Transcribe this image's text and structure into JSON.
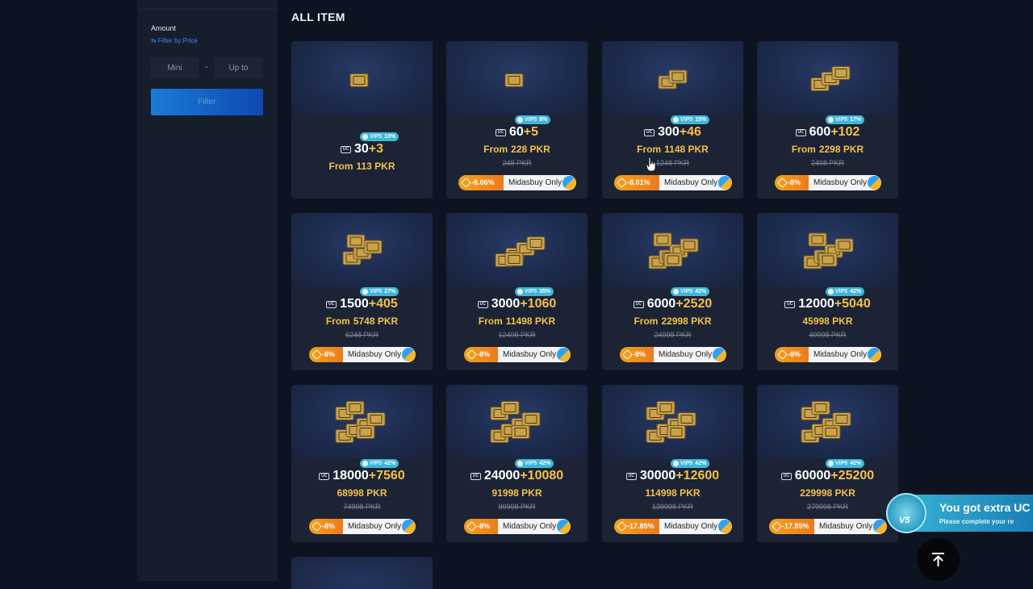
{
  "sidebar": {
    "amount_label": "Amount",
    "filter_by_price": "⇆ Filter by Price",
    "min_placeholder": "Mini",
    "dash": "-",
    "max_placeholder": "Up to",
    "filter_button": "Filter"
  },
  "section_title": "ALL ITEM",
  "colors": {
    "gold": "#f5c04a",
    "vip": "#3fb6d8",
    "discount": "#f3a21b",
    "filter": "#1b7bd6"
  },
  "items": [
    {
      "base": "30",
      "bonus": "+3",
      "vip": "VIP5",
      "vip_pct": "10%",
      "from": "From",
      "price": "113 PKR",
      "original": "",
      "discount": "",
      "badge": ""
    },
    {
      "base": "60",
      "bonus": "+5",
      "vip": "VIP5",
      "vip_pct": "8%",
      "from": "From",
      "price": "228 PKR",
      "original": "248 PKR",
      "discount": "-8.06%",
      "badge": "Midasbuy Only"
    },
    {
      "base": "300",
      "bonus": "+46",
      "vip": "VIP5",
      "vip_pct": "15%",
      "from": "From",
      "price": "1148 PKR",
      "original": "1248 PKR",
      "discount": "-8.01%",
      "badge": "Midasbuy Only"
    },
    {
      "base": "600",
      "bonus": "+102",
      "vip": "VIP5",
      "vip_pct": "17%",
      "from": "From",
      "price": "2298 PKR",
      "original": "2498 PKR",
      "discount": "-8%",
      "badge": "Midasbuy Only"
    },
    {
      "base": "1500",
      "bonus": "+405",
      "vip": "VIP5",
      "vip_pct": "27%",
      "from": "From",
      "price": "5748 PKR",
      "original": "6248 PKR",
      "discount": "-8%",
      "badge": "Midasbuy Only"
    },
    {
      "base": "3000",
      "bonus": "+1060",
      "vip": "VIP5",
      "vip_pct": "35%",
      "from": "From",
      "price": "11498 PKR",
      "original": "12498 PKR",
      "discount": "-8%",
      "badge": "Midasbuy Only"
    },
    {
      "base": "6000",
      "bonus": "+2520",
      "vip": "VIP5",
      "vip_pct": "42%",
      "from": "From",
      "price": "22998 PKR",
      "original": "24998 PKR",
      "discount": "-8%",
      "badge": "Midasbuy Only"
    },
    {
      "base": "12000",
      "bonus": "+5040",
      "vip": "VIP5",
      "vip_pct": "42%",
      "from": "",
      "price": "45998 PKR",
      "original": "49998 PKR",
      "discount": "-8%",
      "badge": "Midasbuy Only"
    },
    {
      "base": "18000",
      "bonus": "+7560",
      "vip": "VIP5",
      "vip_pct": "42%",
      "from": "",
      "price": "68998 PKR",
      "original": "74998 PKR",
      "discount": "-8%",
      "badge": "Midasbuy Only"
    },
    {
      "base": "24000",
      "bonus": "+10080",
      "vip": "VIP5",
      "vip_pct": "42%",
      "from": "",
      "price": "91998 PKR",
      "original": "99998 PKR",
      "discount": "-8%",
      "badge": "Midasbuy Only"
    },
    {
      "base": "30000",
      "bonus": "+12600",
      "vip": "VIP5",
      "vip_pct": "42%",
      "from": "",
      "price": "114998 PKR",
      "original": "139998 PKR",
      "discount": "-17.85%",
      "badge": "Midasbuy Only"
    },
    {
      "base": "60000",
      "bonus": "+25200",
      "vip": "VIP5",
      "vip_pct": "42%",
      "from": "",
      "price": "229998 PKR",
      "original": "279998 PKR",
      "discount": "-17.85%",
      "badge": "Midasbuy Only"
    }
  ],
  "toast": {
    "title": "You got extra UC",
    "subtitle": "Please complete your re",
    "level": "V5"
  },
  "uc_icon_text": "UC"
}
